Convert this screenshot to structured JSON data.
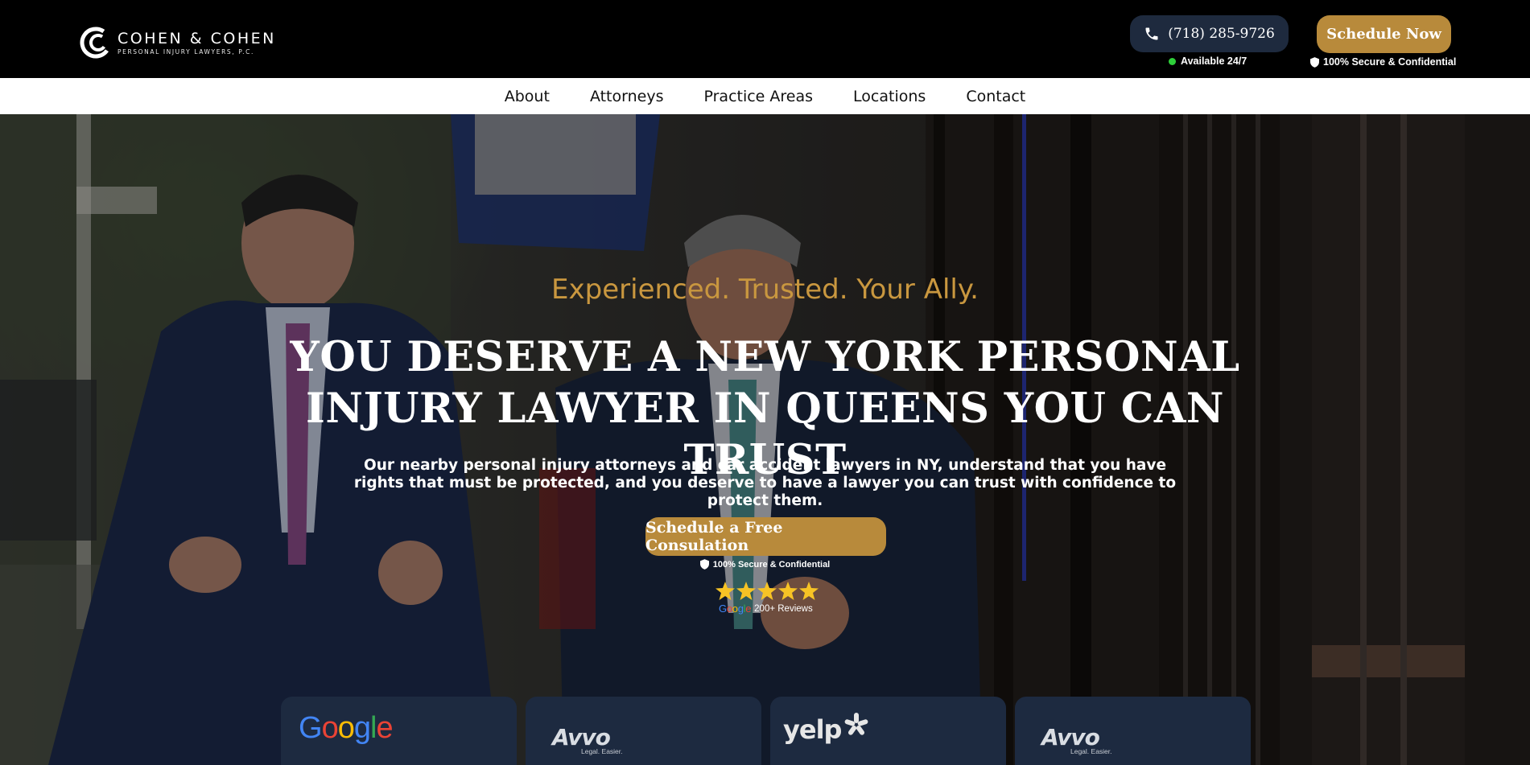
{
  "brand": {
    "name": "COHEN & COHEN",
    "subtitle": "PERSONAL INJURY LAWYERS, P.C."
  },
  "header": {
    "phone": "(718) 285-9726",
    "availability": "Available 24/7",
    "schedule_label": "Schedule Now",
    "secure_label": "100% Secure & Confidential"
  },
  "nav": {
    "items": [
      {
        "label": "About"
      },
      {
        "label": "Attorneys"
      },
      {
        "label": "Practice Areas"
      },
      {
        "label": "Locations"
      },
      {
        "label": "Contact"
      }
    ]
  },
  "hero": {
    "tagline": "Experienced. Trusted. Your Ally.",
    "headline": "YOU DESERVE A NEW YORK PERSONAL INJURY LAWYER IN QUEENS YOU CAN TRUST",
    "subtext": "Our nearby personal injury attorneys and car accident lawyers in NY, understand that you have rights that must be protected, and you deserve to have a lawyer you can trust with confidence to protect them.",
    "cta_label": "Schedule a Free Consulation",
    "secure_label": "100% Secure & Confidential",
    "rating_stars": 5,
    "review_source": "Google",
    "review_count": "200+ Reviews"
  },
  "review_cards": [
    {
      "logo": "Google"
    },
    {
      "logo": "Avvo",
      "tagline": "Legal. Easier."
    },
    {
      "logo": "yelp"
    },
    {
      "logo": "Avvo",
      "tagline": "Legal. Easier."
    }
  ],
  "colors": {
    "accent_gold": "#b88a3b",
    "tagline_gold": "#c9973f",
    "pill_navy": "#1e2a3e",
    "card_navy": "#1d2a40",
    "available_green": "#2ed03a",
    "star_yellow": "#f7c325"
  },
  "icons": {
    "phone": "phone-icon",
    "shield": "shield-icon",
    "star": "star-icon",
    "logo": "cohen-logo-mark"
  }
}
